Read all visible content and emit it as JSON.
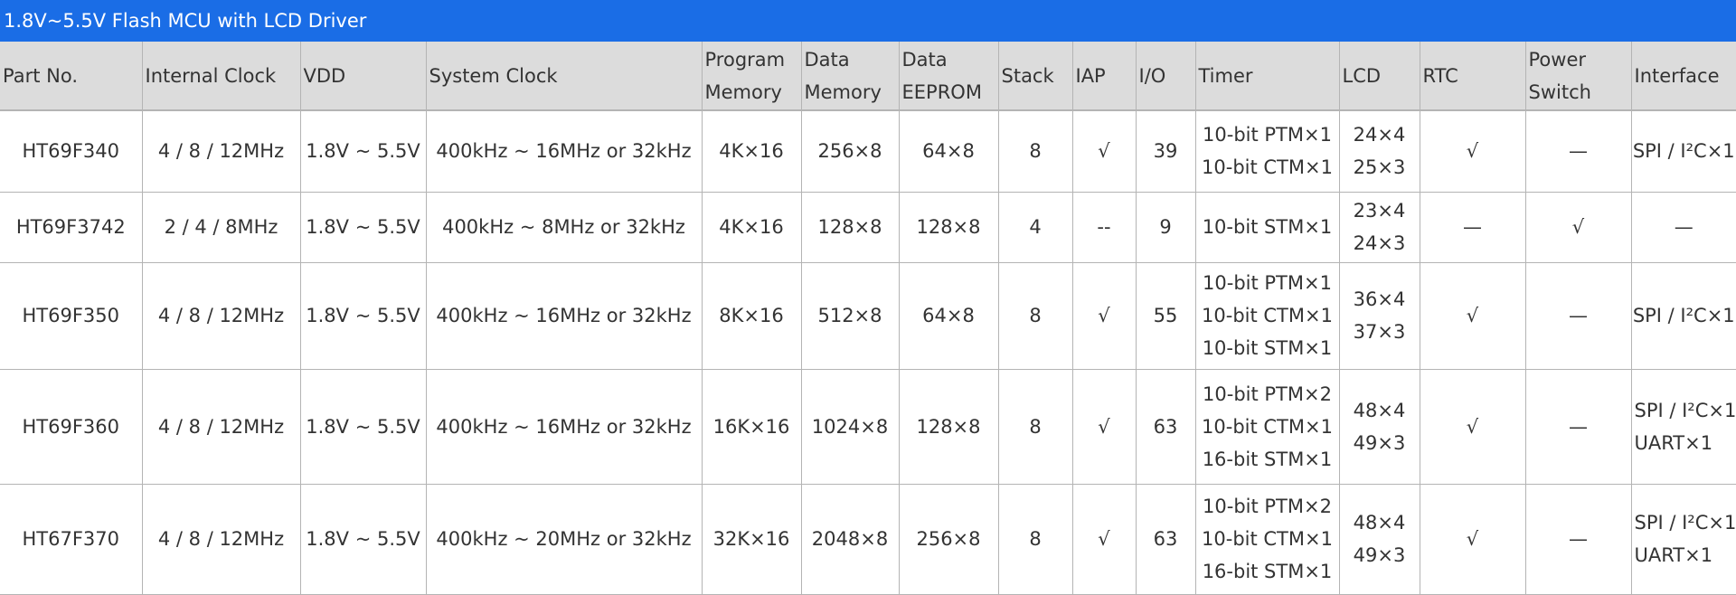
{
  "title": "1.8V~5.5V Flash MCU with LCD Driver",
  "headers": [
    [
      "Part No."
    ],
    [
      "Internal Clock"
    ],
    [
      "VDD"
    ],
    [
      "System Clock"
    ],
    [
      "Program",
      "Memory"
    ],
    [
      "Data",
      "Memory"
    ],
    [
      "Data",
      "EEPROM"
    ],
    [
      "Stack"
    ],
    [
      "IAP"
    ],
    [
      "I/O"
    ],
    [
      "Timer"
    ],
    [
      "LCD"
    ],
    [
      "RTC"
    ],
    [
      "Power",
      "Switch"
    ],
    [
      "Interface"
    ]
  ],
  "rows": [
    {
      "part": "HT69F340",
      "internal_clock": "4 / 8 / 12MHz",
      "vdd": "1.8V ~ 5.5V",
      "system_clock": "400kHz ~ 16MHz or 32kHz",
      "program_memory": "4K×16",
      "data_memory": "256×8",
      "data_eeprom": "64×8",
      "stack": "8",
      "iap": "√",
      "io": "39",
      "timer": [
        "10-bit PTM×1",
        "10-bit CTM×1"
      ],
      "lcd": [
        "24×4",
        "25×3"
      ],
      "rtc": "√",
      "power_switch": "—",
      "interface": [
        "SPI / I²C×1"
      ]
    },
    {
      "part": "HT69F3742",
      "internal_clock": "2 / 4 / 8MHz",
      "vdd": "1.8V ~ 5.5V",
      "system_clock": "400kHz ~ 8MHz or 32kHz",
      "program_memory": "4K×16",
      "data_memory": "128×8",
      "data_eeprom": "128×8",
      "stack": "4",
      "iap": "--",
      "io": "9",
      "timer": [
        "10-bit STM×1"
      ],
      "lcd": [
        "23×4",
        "24×3"
      ],
      "rtc": "—",
      "power_switch": "√",
      "interface": [
        "—"
      ]
    },
    {
      "part": "HT69F350",
      "internal_clock": "4 / 8 / 12MHz",
      "vdd": "1.8V ~ 5.5V",
      "system_clock": "400kHz ~ 16MHz or 32kHz",
      "program_memory": "8K×16",
      "data_memory": "512×8",
      "data_eeprom": "64×8",
      "stack": "8",
      "iap": "√",
      "io": "55",
      "timer": [
        "10-bit PTM×1",
        "10-bit CTM×1",
        "10-bit STM×1"
      ],
      "lcd": [
        "36×4",
        "37×3"
      ],
      "rtc": "√",
      "power_switch": "—",
      "interface": [
        "SPI / I²C×1"
      ]
    },
    {
      "part": "HT69F360",
      "internal_clock": "4 / 8 / 12MHz",
      "vdd": "1.8V ~ 5.5V",
      "system_clock": "400kHz ~ 16MHz or 32kHz",
      "program_memory": "16K×16",
      "data_memory": "1024×8",
      "data_eeprom": "128×8",
      "stack": "8",
      "iap": "√",
      "io": "63",
      "timer": [
        "10-bit PTM×2",
        "10-bit CTM×1",
        "16-bit STM×1"
      ],
      "lcd": [
        "48×4",
        "49×3"
      ],
      "rtc": "√",
      "power_switch": "—",
      "interface": [
        "SPI / I²C×1",
        "UART×1"
      ]
    },
    {
      "part": "HT67F370",
      "internal_clock": "4 / 8 / 12MHz",
      "vdd": "1.8V ~ 5.5V",
      "system_clock": "400kHz ~ 20MHz or 32kHz",
      "program_memory": "32K×16",
      "data_memory": "2048×8",
      "data_eeprom": "256×8",
      "stack": "8",
      "iap": "√",
      "io": "63",
      "timer": [
        "10-bit PTM×2",
        "10-bit CTM×1",
        "16-bit STM×1"
      ],
      "lcd": [
        "48×4",
        "49×3"
      ],
      "rtc": "√",
      "power_switch": "—",
      "interface": [
        "SPI / I²C×1",
        "UART×1"
      ]
    }
  ]
}
